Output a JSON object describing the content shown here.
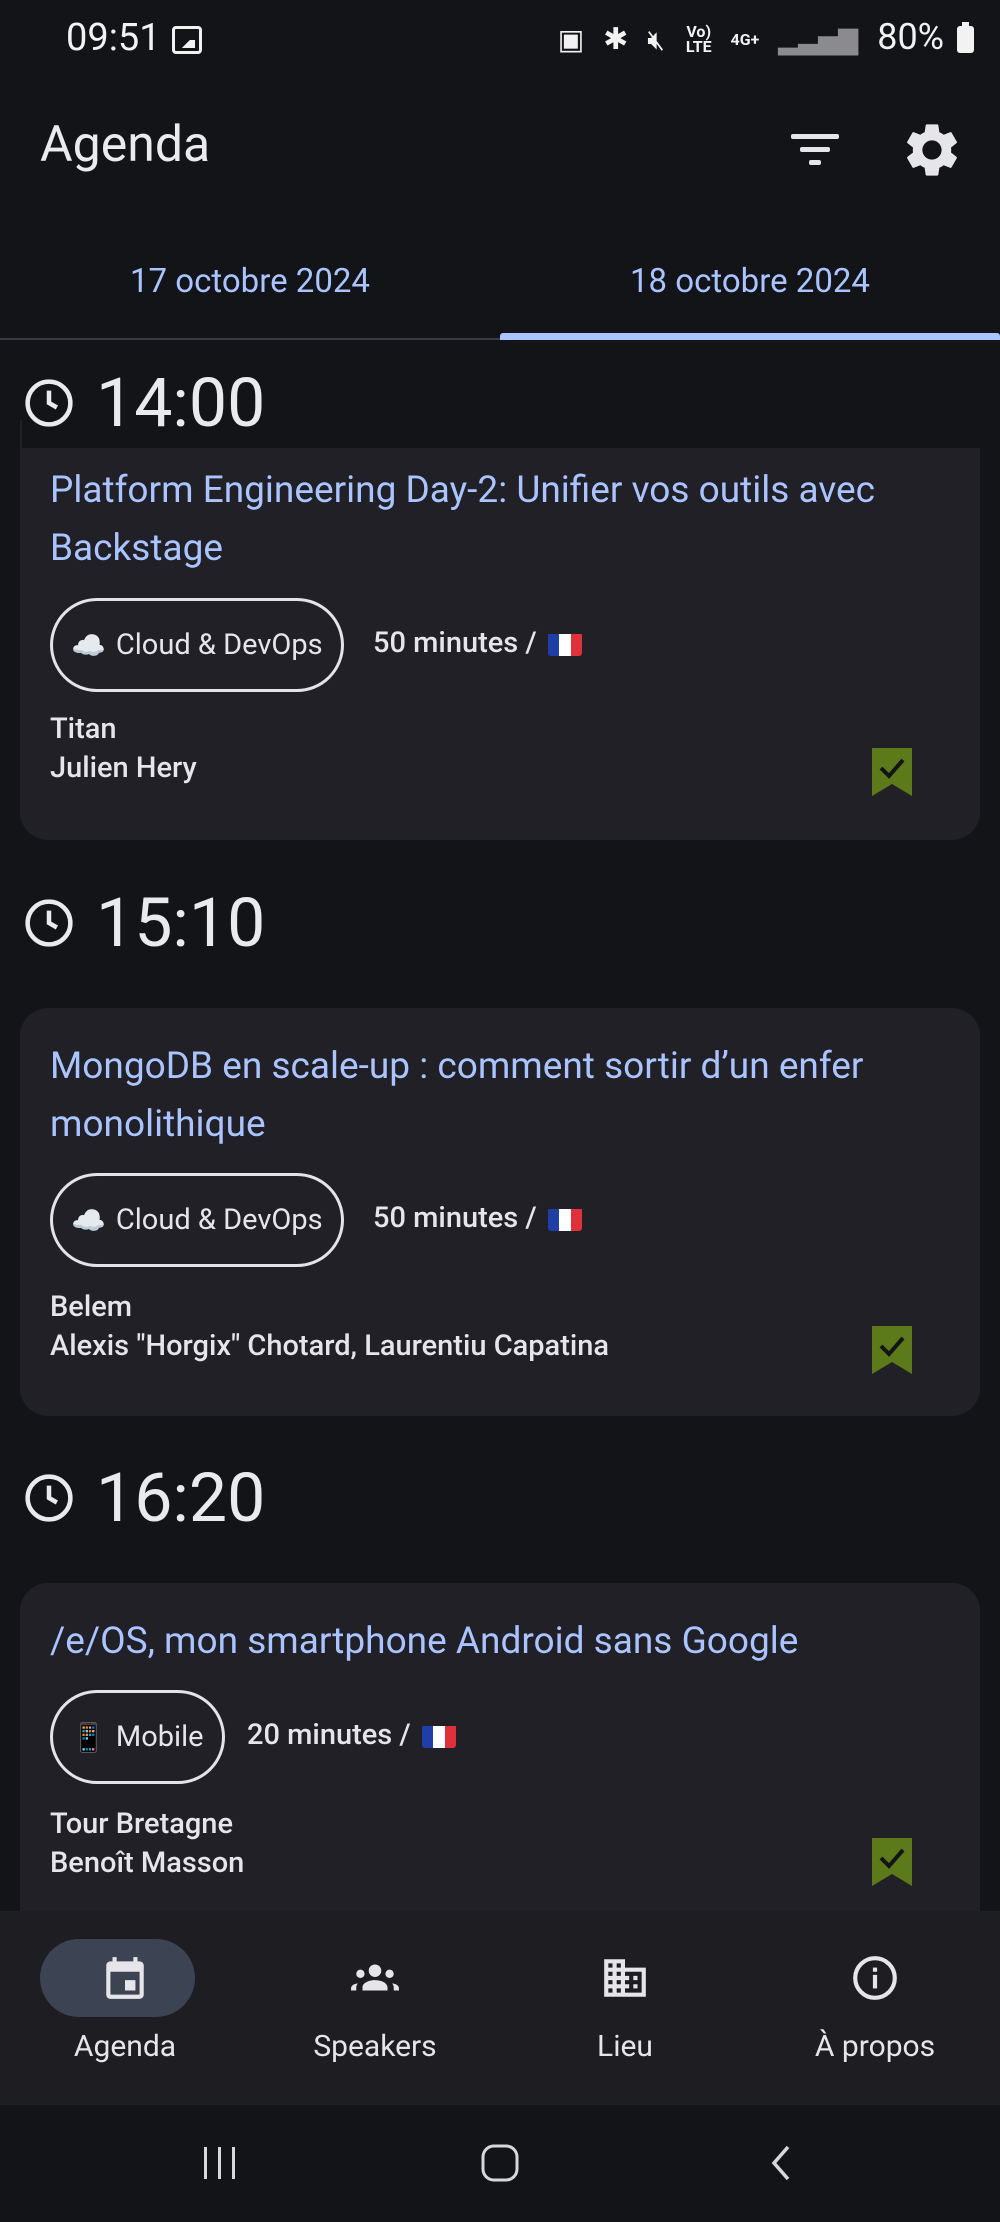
{
  "status_bar": {
    "time": "09:51",
    "volte": "Vo)\nLTE",
    "network": "4G+",
    "battery": "80%"
  },
  "app_bar": {
    "title": "Agenda",
    "filter_icon": "filter-icon",
    "settings_icon": "gear-icon"
  },
  "tabs": [
    {
      "label": "17 octobre 2024",
      "selected": false
    },
    {
      "label": "18 octobre 2024",
      "selected": true
    }
  ],
  "slots": [
    {
      "time": "14:00",
      "talk": {
        "title": "Platform Engineering Day-2: Unifier vos outils avec Backstage",
        "track_emoji": "☁️",
        "track": "Cloud & DevOps",
        "duration": "50 minutes /",
        "language_flag": "FR",
        "room": "Titan",
        "speakers": "Julien Hery",
        "bookmarked": true
      }
    },
    {
      "time": "15:10",
      "talk": {
        "title": "MongoDB en scale-up : comment sortir d’un enfer monolithique",
        "track_emoji": "☁️",
        "track": "Cloud & DevOps",
        "duration": "50 minutes /",
        "language_flag": "FR",
        "room": "Belem",
        "speakers": "Alexis \"Horgix\" Chotard, Laurentiu Capatina",
        "bookmarked": true
      }
    },
    {
      "time": "16:20",
      "talk": {
        "title": "/e/OS, mon smartphone Android sans Google",
        "track_emoji": "📱",
        "track": "Mobile",
        "duration": "20 minutes /",
        "language_flag": "FR",
        "room": "Tour Bretagne",
        "speakers": "Benoît Masson",
        "bookmarked": true
      }
    }
  ],
  "bottom_nav": [
    {
      "label": "Agenda",
      "icon": "calendar-icon",
      "selected": true
    },
    {
      "label": "Speakers",
      "icon": "people-icon",
      "selected": false
    },
    {
      "label": "Lieu",
      "icon": "building-icon",
      "selected": false
    },
    {
      "label": "À propos",
      "icon": "info-icon",
      "selected": false
    }
  ],
  "colors": {
    "background": "#131418",
    "card": "#202026",
    "accent": "#aac4ff",
    "bookmark": "#5c7a19",
    "nav_pill": "#3c4352"
  }
}
